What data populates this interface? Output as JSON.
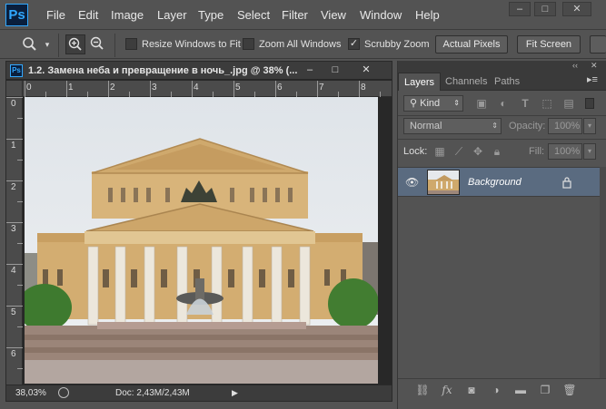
{
  "app": {
    "logo": "Ps"
  },
  "menu": [
    "File",
    "Edit",
    "Image",
    "Layer",
    "Type",
    "Select",
    "Filter",
    "View",
    "Window",
    "Help"
  ],
  "window_controls": {
    "minimize": "–",
    "maximize": "□",
    "close": "✕"
  },
  "options": {
    "tool_icon": "zoom-tool-icon",
    "resize_windows_label": "Resize Windows to Fit",
    "resize_windows_checked": false,
    "zoom_all_label": "Zoom All Windows",
    "zoom_all_checked": false,
    "scrubby_zoom_label": "Scrubby Zoom",
    "scrubby_zoom_checked": true,
    "actual_pixels_label": "Actual Pixels",
    "fit_screen_label": "Fit Screen"
  },
  "document": {
    "title": "1.2. Замена неба и превращение в ночь_.jpg @ 38% (...",
    "ruler_h": [
      "0",
      "1",
      "2",
      "3",
      "4",
      "5",
      "6",
      "7",
      "8"
    ],
    "ruler_v": [
      "0",
      "1",
      "2",
      "3",
      "4",
      "5",
      "6"
    ],
    "zoom": "38,03%",
    "doc_info": "Doc: 2,43M/2,43M"
  },
  "layers_panel": {
    "tabs": [
      "Layers",
      "Channels",
      "Paths"
    ],
    "active_tab": "Layers",
    "filter_kind": "Kind",
    "blend_mode": "Normal",
    "opacity_label": "Opacity:",
    "opacity_value": "100%",
    "lock_label": "Lock:",
    "fill_label": "Fill:",
    "fill_value": "100%",
    "layers": [
      {
        "name": "Background",
        "visible": true,
        "locked": true
      }
    ]
  },
  "colors": {
    "ui_bg": "#535353",
    "selected_layer": "#5a6b80",
    "ps_blue": "#31a8ff"
  }
}
